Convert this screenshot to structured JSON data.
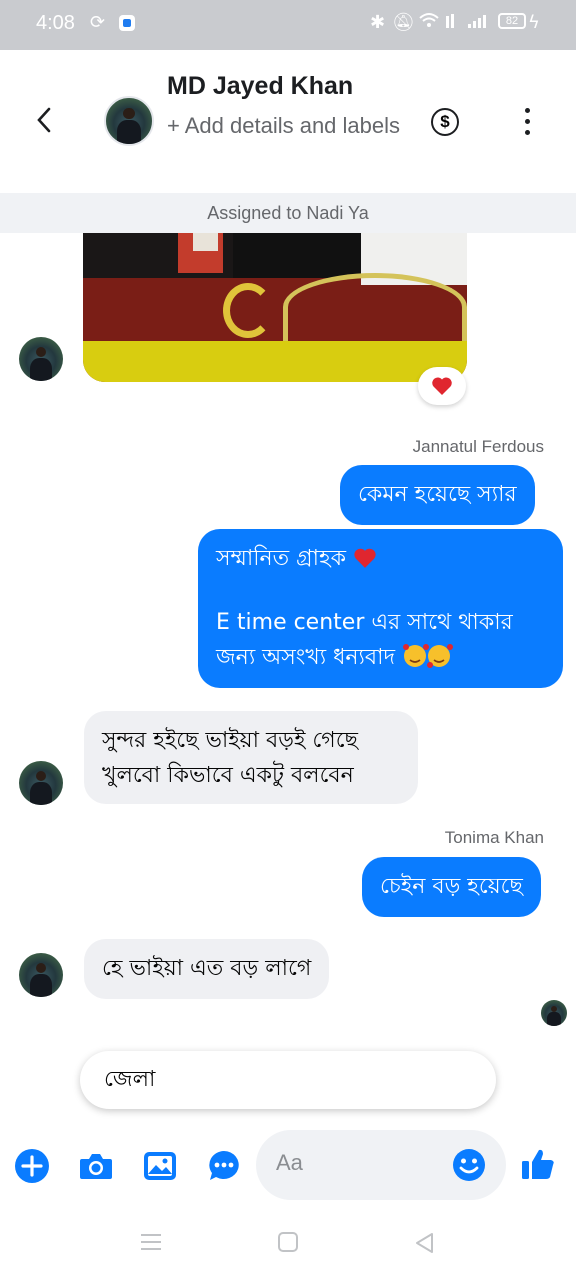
{
  "status_bar": {
    "time": "4:08",
    "battery": "82"
  },
  "header": {
    "name": "MD Jayed Khan",
    "subtitle": "+ Add details and labels",
    "dollar_symbol": "$"
  },
  "assigned_banner": "Assigned to Nadi Ya",
  "messages": {
    "sender_1": "Jannatul Ferdous",
    "out_1": "কেমন হয়েছে স্যার",
    "out_2_line1": "সম্মানিত গ্রাহক",
    "out_2_line2": "E time center  এর সাথে থাকার",
    "out_2_line3": "জন্য অসংখ্য ধন্যবাদ",
    "in_1_line1": "সুন্দর হইছে ভাইয়া বড়ই গেছে",
    "in_1_line2": "খুলবো কিভাবে একটু বলবেন",
    "sender_2": "Tonima Khan",
    "out_3": "চেইন বড় হয়েছে",
    "in_2": "হে ভাইয়া এত বড় লাগে"
  },
  "suggestion": "জেলা",
  "composer": {
    "placeholder": "Aa"
  },
  "colors": {
    "accent": "#0a7cff",
    "incoming_bubble": "#eff0f3",
    "heart": "#e0262f"
  },
  "icons": [
    "back-icon",
    "dollar-icon",
    "more-icon",
    "heart-icon",
    "plus-icon",
    "camera-icon",
    "gallery-icon",
    "chat-bubble-icon",
    "emoji-icon",
    "thumbs-up-icon",
    "menu-icon",
    "home-icon",
    "back-nav-icon"
  ]
}
